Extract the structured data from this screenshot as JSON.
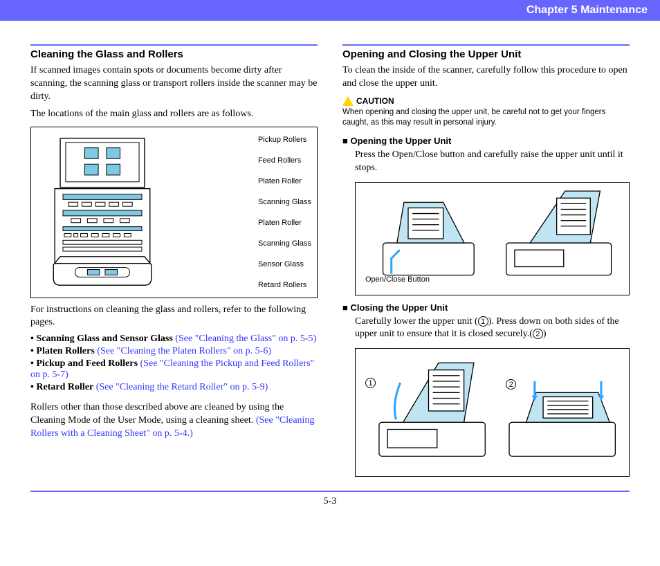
{
  "header": {
    "chapter": "Chapter 5   Maintenance"
  },
  "left": {
    "title": "Cleaning the Glass and Rollers",
    "p1": "If scanned images contain spots or documents become dirty after scanning, the scanning glass or transport rollers inside the scanner may be dirty.",
    "p2": "The locations of the main glass and rollers are as follows.",
    "labels": {
      "l1": "Pickup Rollers",
      "l2": "Feed Rollers",
      "l3": "Platen Roller",
      "l4": "Scanning Glass",
      "l5": "Platen Roller",
      "l6": "Scanning Glass",
      "l7": "Sensor Glass",
      "l8": "Retard Rollers"
    },
    "p3": "For instructions on cleaning the glass and rollers, refer to the following pages.",
    "b1_bold": "• Scanning Glass and Sensor Glass",
    "b1_link": " (See \"Cleaning the Glass\" on p. 5-5)",
    "b2_bold": "• Platen Rollers",
    "b2_link": " (See \"Cleaning the Platen Rollers\" on p. 5-6)",
    "b3_bold": "• Pickup and Feed Rollers",
    "b3_link": " (See \"Cleaning the Pickup and Feed Rollers\" on p. 5-7)",
    "b4_bold": "• Retard Roller",
    "b4_link": " (See \"Cleaning the Retard Roller\" on p. 5-9)",
    "p4": "Rollers other than those described above are cleaned by using the Cleaning Mode of the User Mode, using a cleaning sheet.",
    "p4_link": "(See \"Cleaning Rollers with a Cleaning Sheet\" on p. 5-4.)"
  },
  "right": {
    "title": "Opening and Closing the Upper Unit",
    "p1": "To clean the inside of the scanner, carefully follow this procedure to open and close the upper unit.",
    "caution_label": "CAUTION",
    "caution_body": "When opening and closing the upper unit, be careful not to get your fingers caught, as this may result in personal injury.",
    "open_head": "■ Opening the Upper Unit",
    "open_body": "Press the Open/Close button and carefully raise the upper unit until it stops.",
    "fig2_label": "Open/Close Button",
    "close_head": "■ Closing the Upper Unit",
    "close_body_a": "Carefully lower the upper unit (",
    "close_body_b": "). Press down on both sides of the upper unit to ensure that it is closed securely.(",
    "close_body_c": ")",
    "n1": "1",
    "n2": "2"
  },
  "footer": {
    "page": "5-3"
  }
}
